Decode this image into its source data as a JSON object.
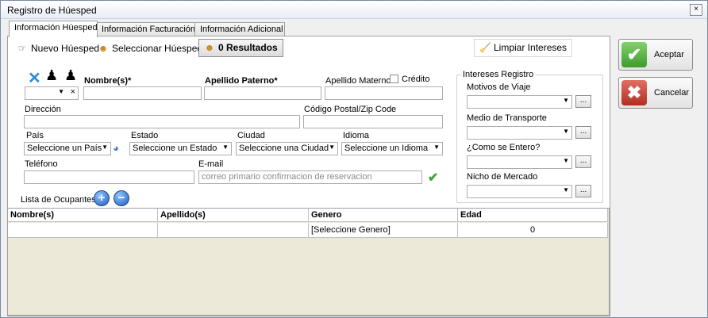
{
  "window": {
    "title": "Registro de Húesped",
    "close_glyph": "×"
  },
  "tabs": [
    {
      "label": "Información Húesped",
      "active": true
    },
    {
      "label": "Información Facturación",
      "active": false
    },
    {
      "label": "Información Adicional",
      "active": false
    }
  ],
  "toolbar": {
    "nuevo": "Nuevo Húesped",
    "seleccionar": "Seleccionar Húesped",
    "resultados": "0 Resultados",
    "limpiar": "Limpiar Intereses"
  },
  "form": {
    "nombre_label": "Nombre(s)*",
    "apellido_paterno_label": "Apellido Paterno*",
    "apellido_materno_label": "Apellido Materno",
    "credito_label": "Crédito",
    "direccion_label": "Dirección",
    "codigo_label": "Código Postal/Zip Code",
    "pais_label": "País",
    "pais_value": "Seleccione un País",
    "estado_label": "Estado",
    "estado_value": "Seleccione un Estado",
    "ciudad_label": "Ciudad",
    "ciudad_value": "Seleccione una Ciudad",
    "idioma_label": "Idioma",
    "idioma_value": "Seleccione un Idioma",
    "telefono_label": "Teléfono",
    "email_label": "E-mail",
    "email_placeholder": "correo primario confirmacion de reservacion",
    "ocupantes_label": "Lista de Ocupantes:",
    "clear_glyph": "×"
  },
  "intereses": {
    "title": "Intereses Registro",
    "motivos_label": "Motivos de Viaje",
    "medio_label": "Medio de Transporte",
    "como_label": "¿Como se Entero?",
    "nicho_label": "Nicho de Mercado",
    "more_label": "..."
  },
  "grid": {
    "columns": [
      "Nombre(s)",
      "Apellido(s)",
      "Genero",
      "Edad"
    ],
    "rows": [
      {
        "nombre": "",
        "apellido": "",
        "genero": "[Seleccione Genero]",
        "edad": "0"
      }
    ]
  },
  "buttons": {
    "aceptar": "Aceptar",
    "cancelar": "Cancelar"
  },
  "colors": {
    "accept_green": "#4caf3a",
    "cancel_red": "#c83a2e",
    "blue_icon": "#2b8fd6"
  }
}
